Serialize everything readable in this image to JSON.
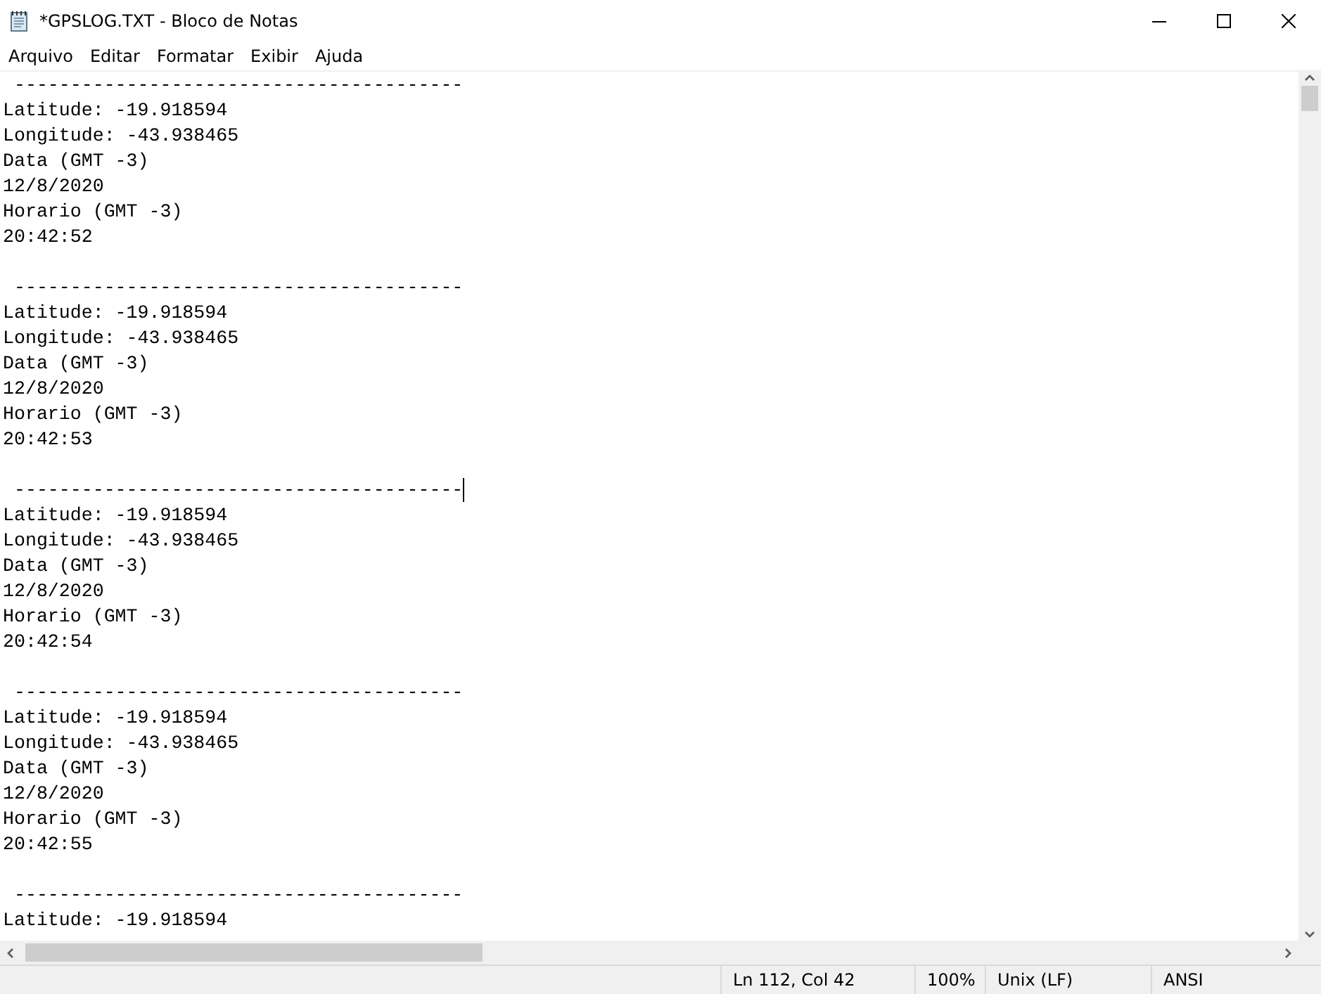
{
  "window": {
    "title": "*GPSLOG.TXT - Bloco de Notas"
  },
  "menu": [
    "Arquivo",
    "Editar",
    "Formatar",
    "Exibir",
    "Ajuda"
  ],
  "blocks": [
    {
      "separator": " ----------------------------------------",
      "caret": false,
      "lines": [
        "Latitude: -19.918594",
        "Longitude: -43.938465",
        "Data (GMT -3)",
        "12/8/2020",
        "Horario (GMT -3)",
        "20:42:52"
      ]
    },
    {
      "separator": " ----------------------------------------",
      "caret": false,
      "lines": [
        "Latitude: -19.918594",
        "Longitude: -43.938465",
        "Data (GMT -3)",
        "12/8/2020",
        "Horario (GMT -3)",
        "20:42:53"
      ]
    },
    {
      "separator": " ----------------------------------------",
      "caret": true,
      "lines": [
        "Latitude: -19.918594",
        "Longitude: -43.938465",
        "Data (GMT -3)",
        "12/8/2020",
        "Horario (GMT -3)",
        "20:42:54"
      ]
    },
    {
      "separator": " ----------------------------------------",
      "caret": false,
      "lines": [
        "Latitude: -19.918594",
        "Longitude: -43.938465",
        "Data (GMT -3)",
        "12/8/2020",
        "Horario (GMT -3)",
        "20:42:55"
      ]
    },
    {
      "separator": " ----------------------------------------",
      "caret": false,
      "lines": [
        "Latitude: -19.918594"
      ]
    }
  ],
  "status_bar": {
    "position": "Ln 112, Col 42",
    "zoom": "100%",
    "line_ending": "Unix (LF)",
    "encoding": "ANSI"
  }
}
